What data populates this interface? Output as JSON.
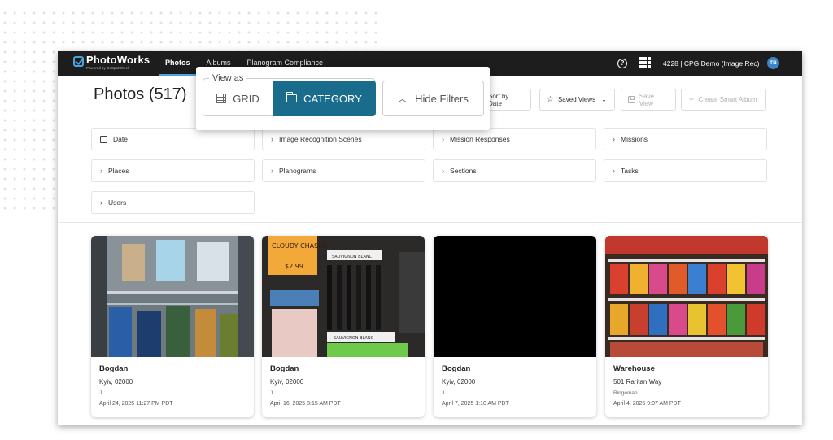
{
  "nav": {
    "brand": "PhotoWorks",
    "brand_sub": "Powered by GoSpotCheck",
    "links": [
      "Photos",
      "Albums",
      "Planogram Compliance"
    ],
    "active_link": "Photos",
    "help_icon": "help-circle-icon",
    "apps_icon": "grid-apps-icon",
    "account": "4228 | CPG Demo (Image Rec)",
    "avatar_initials": "TB"
  },
  "header": {
    "title": "Photos (517)",
    "sort_label": "Sort by Date",
    "saved_views_label": "Saved Views",
    "save_view_label": "Save View",
    "smart_album_label": "Create Smart Album"
  },
  "view_as": {
    "legend": "View as",
    "grid_label": "GRID",
    "category_label": "CATEGORY",
    "hide_filters_label": "Hide Filters",
    "selected": "CATEGORY",
    "accent": "#1a6c8c"
  },
  "filters": [
    "Date",
    "Image Recognition Scenes",
    "Mission Responses",
    "Missions",
    "Places",
    "Planograms",
    "Sections",
    "Tasks",
    "Users"
  ],
  "photos": [
    {
      "title": "Bogdan",
      "location": "Kyiv, 02000",
      "sub": "J",
      "date": "April 24, 2025 11:27 PM PDT"
    },
    {
      "title": "Bogdan",
      "location": "Kyiv, 02000",
      "sub": "J",
      "date": "April 16, 2025 8:15 AM PDT"
    },
    {
      "title": "Bogdan",
      "location": "Kyiv, 02000",
      "sub": "J",
      "date": "April 7, 2025 1:10 AM PDT"
    },
    {
      "title": "Warehouse",
      "location": "501 Raritan Way",
      "sub": "Ringeman",
      "date": "April 4, 2025 9:07 AM PDT"
    }
  ],
  "image_texts": {
    "cloudy_chaser": "CLOUDY CHASER",
    "price": "$2.99",
    "sauvignon_1": "SAUVIGNON BLANC",
    "sauvignon_2": "SAUVIGNON BLANC"
  }
}
